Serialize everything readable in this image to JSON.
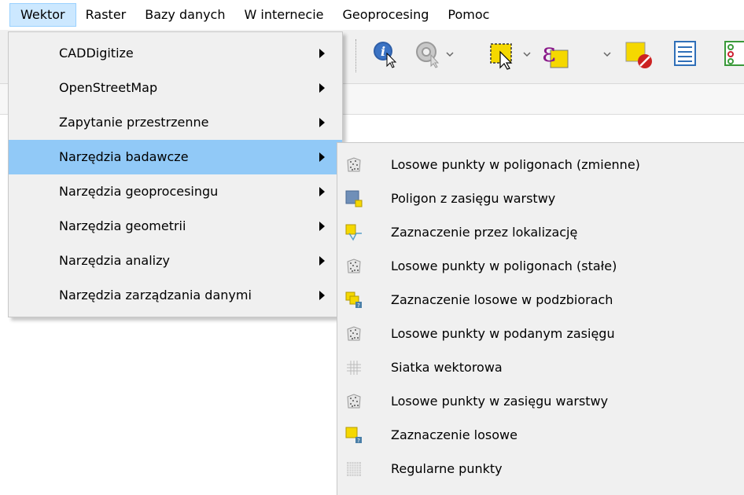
{
  "menubar": {
    "items": [
      "Wektor",
      "Raster",
      "Bazy danych",
      "W internecie",
      "Geoprocesing",
      "Pomoc"
    ]
  },
  "vector_menu": {
    "items": [
      "CADDigitize",
      "OpenStreetMap",
      "Zapytanie przestrzenne",
      "Narzędzia badawcze",
      "Narzędzia geoprocesingu",
      "Narzędzia geometrii",
      "Narzędzia analizy",
      "Narzędzia zarządzania danymi"
    ],
    "highlighted": "Narzędzia badawcze"
  },
  "research_tools_submenu": {
    "items": [
      {
        "label": "Losowe punkty w poligonach (zmienne)",
        "icon": "random-points-icon"
      },
      {
        "label": "Poligon z zasięgu warstwy",
        "icon": "polygon-extent-icon"
      },
      {
        "label": "Zaznaczenie przez lokalizację",
        "icon": "select-by-location-icon"
      },
      {
        "label": "Losowe punkty w poligonach (stałe)",
        "icon": "random-points-icon"
      },
      {
        "label": "Zaznaczenie losowe w podzbiorach",
        "icon": "random-selection-subsets-icon"
      },
      {
        "label": "Losowe punkty w podanym zasięgu",
        "icon": "random-points-icon"
      },
      {
        "label": "Siatka wektorowa",
        "icon": "vector-grid-icon"
      },
      {
        "label": "Losowe punkty w zasięgu warstwy",
        "icon": "random-points-icon"
      },
      {
        "label": "Zaznaczenie losowe",
        "icon": "random-selection-icon"
      },
      {
        "label": "Regularne punkty",
        "icon": "regular-points-icon"
      }
    ]
  },
  "colors": {
    "highlight": "#91c9f7",
    "menubar_active": "#cce8ff",
    "menu_bg": "#f0f0f0"
  }
}
